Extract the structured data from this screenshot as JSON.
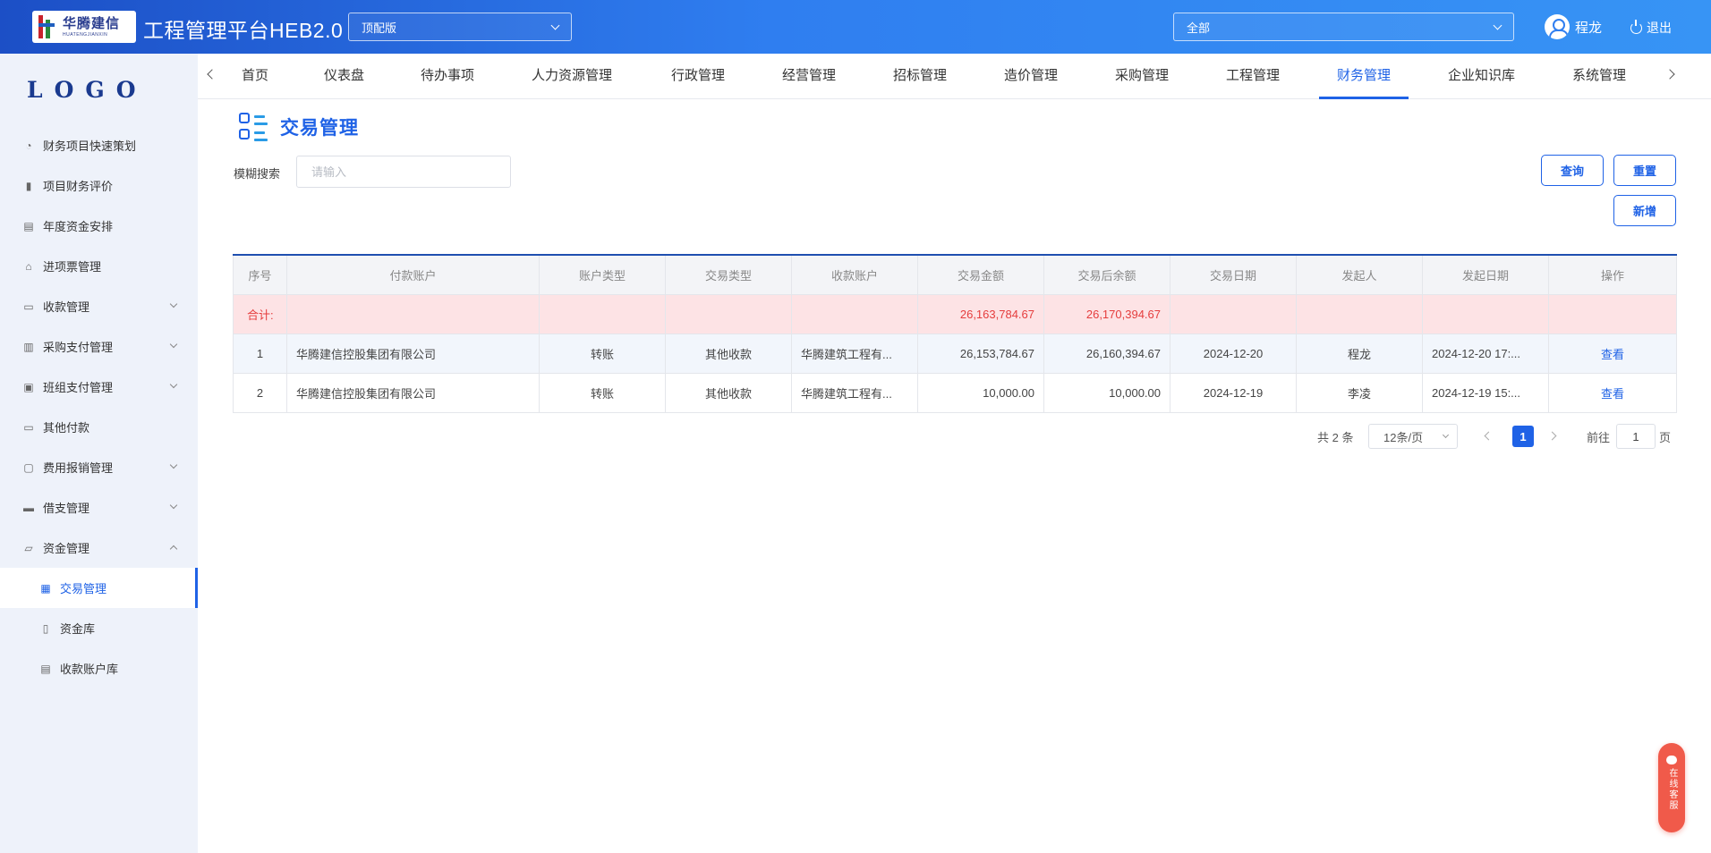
{
  "header": {
    "brand_cn": "华腾建信",
    "brand_en": "HUATENGJIANXIN",
    "app_title": "工程管理平台HEB2.0",
    "version_select": "顶配版",
    "scope_select": "全部",
    "user_name": "程龙",
    "logout_label": "退出"
  },
  "sidebar": {
    "logo": "LOGO",
    "items": [
      {
        "label": "财务项目快速策划",
        "icon": "pie-chart-icon"
      },
      {
        "label": "项目财务评价",
        "icon": "bar-chart-icon"
      },
      {
        "label": "年度资金安排",
        "icon": "document-icon"
      },
      {
        "label": "进项票管理",
        "icon": "home-icon"
      },
      {
        "label": "收款管理",
        "icon": "monitor-icon"
      },
      {
        "label": "采购支付管理",
        "icon": "chart-icon"
      },
      {
        "label": "班组支付管理",
        "icon": "briefcase-icon"
      },
      {
        "label": "其他付款",
        "icon": "card-icon"
      },
      {
        "label": "费用报销管理",
        "icon": "receipt-icon"
      },
      {
        "label": "借支管理",
        "icon": "ticket-icon"
      },
      {
        "label": "资金管理",
        "icon": "folder-icon"
      },
      {
        "label": "交易管理",
        "icon": "building-icon"
      },
      {
        "label": "资金库",
        "icon": "book-icon"
      },
      {
        "label": "收款账户库",
        "icon": "list-icon"
      }
    ]
  },
  "nav": {
    "tabs": [
      "首页",
      "仪表盘",
      "待办事项",
      "人力资源管理",
      "行政管理",
      "经营管理",
      "招标管理",
      "造价管理",
      "采购管理",
      "工程管理",
      "财务管理",
      "企业知识库",
      "系统管理"
    ],
    "active": "财务管理"
  },
  "main": {
    "title": "交易管理",
    "search_label": "模糊搜索",
    "search_placeholder": "请输入",
    "query_button": "查询",
    "reset_button": "重置",
    "add_button": "新增"
  },
  "table": {
    "headers": [
      "序号",
      "付款账户",
      "账户类型",
      "交易类型",
      "收款账户",
      "交易金额",
      "交易后余额",
      "交易日期",
      "发起人",
      "发起日期",
      "操作"
    ],
    "summary": {
      "label": "合计:",
      "amount": "26,163,784.67",
      "balance": "26,170,394.67"
    },
    "rows": [
      {
        "no": "1",
        "pay_account": "华腾建信控股集团有限公司",
        "account_type": "转账",
        "trade_type": "其他收款",
        "receive_account": "华腾建筑工程有...",
        "amount": "26,153,784.67",
        "balance": "26,160,394.67",
        "date": "2024-12-20",
        "initiator": "程龙",
        "init_date": "2024-12-20 17:...",
        "action": "查看"
      },
      {
        "no": "2",
        "pay_account": "华腾建信控股集团有限公司",
        "account_type": "转账",
        "trade_type": "其他收款",
        "receive_account": "华腾建筑工程有...",
        "amount": "10,000.00",
        "balance": "10,000.00",
        "date": "2024-12-19",
        "initiator": "李凌",
        "init_date": "2024-12-19 15:...",
        "action": "查看"
      }
    ]
  },
  "pagination": {
    "total": "共 2 条",
    "page_size": "12条/页",
    "current": "1",
    "goto_label": "前往",
    "goto_value": "1",
    "page_suffix": "页"
  },
  "service": {
    "label": "在线客服"
  },
  "colors": {
    "primary": "#1f62e6",
    "summary_bg": "#fde3e5",
    "summary_text": "#e53d3d",
    "sidebar_bg": "#eef2fa"
  }
}
